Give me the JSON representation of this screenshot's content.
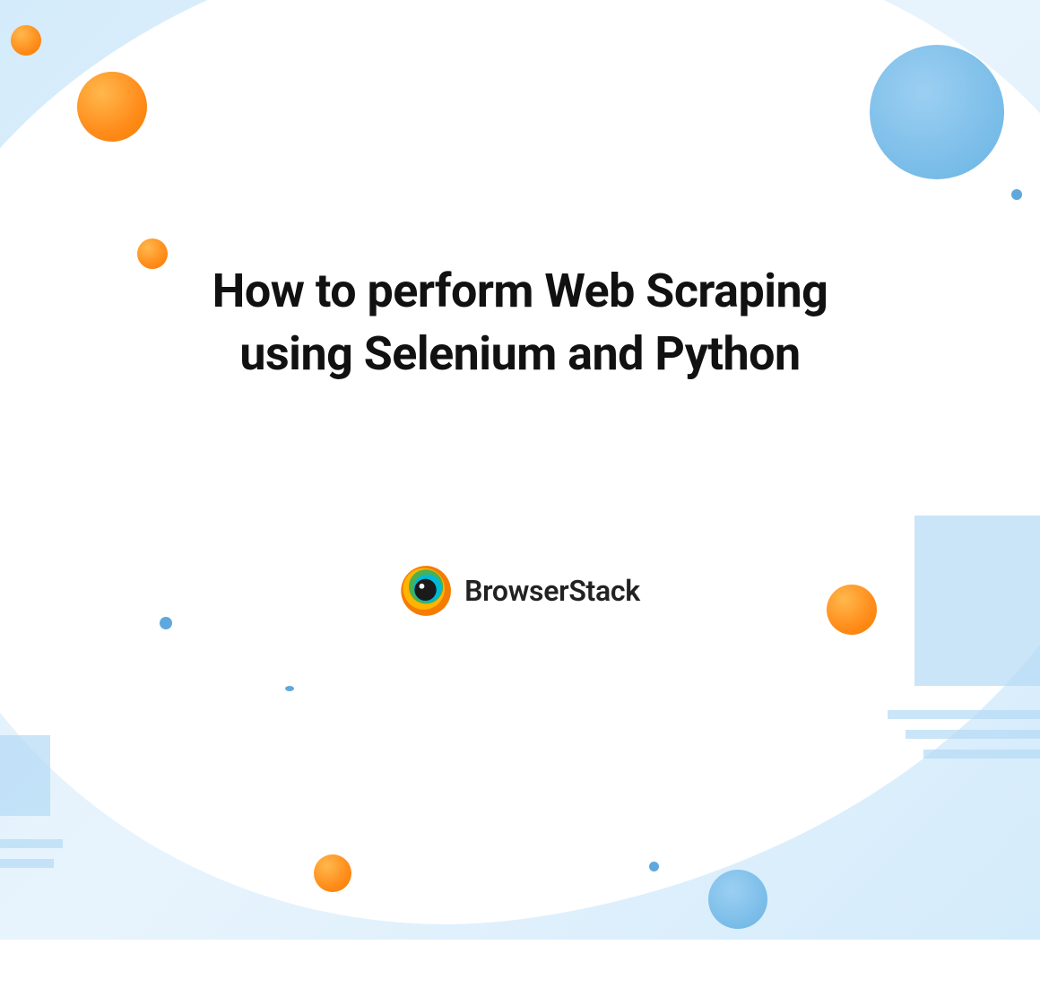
{
  "title": "How to perform Web Scraping using Selenium and Python",
  "brand": "BrowserStack"
}
